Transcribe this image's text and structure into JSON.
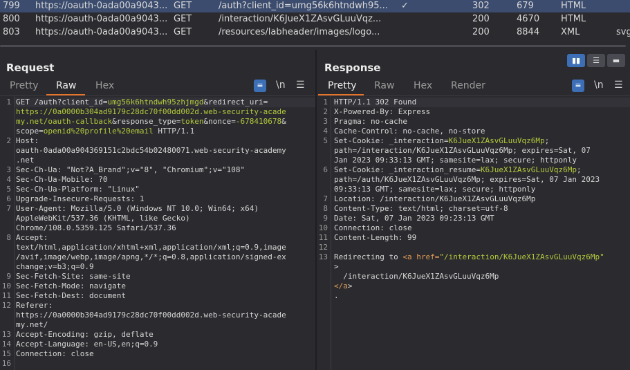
{
  "table": {
    "rows": [
      {
        "num": "799",
        "host": "https://oauth-0ada00a9043...",
        "method": "GET",
        "url": "/auth?client_id=umg56k6htndwh95...",
        "check": "✓",
        "status": "302",
        "length": "679",
        "mime": "HTML",
        "ext": ""
      },
      {
        "num": "800",
        "host": "https://oauth-0ada00a9043...",
        "method": "GET",
        "url": "/interaction/K6JueX1ZAsvGLuuVqz...",
        "check": "",
        "status": "200",
        "length": "4670",
        "mime": "HTML",
        "ext": ""
      },
      {
        "num": "803",
        "host": "https://oauth-0ada00a9043...",
        "method": "GET",
        "url": "/resources/labheader/images/logo...",
        "check": "",
        "status": "200",
        "length": "8844",
        "mime": "XML",
        "ext": "svg"
      }
    ]
  },
  "request": {
    "title": "Request",
    "tabs": [
      "Pretty",
      "Raw",
      "Hex"
    ],
    "wrap_icon": "wrap-icon",
    "newline_label": "\\n",
    "menu_icon": "menu-icon",
    "lines": [
      {
        "n": "1",
        "parts": [
          [
            "k",
            "GET /auth?client_id="
          ],
          [
            "v",
            "umg56k6htndwh95zhjmgd"
          ],
          [
            "k",
            "&redirect_uri="
          ]
        ]
      },
      {
        "n": "",
        "parts": [
          [
            "v",
            "https://0a0000b304ad9179c28dc70f00dd002d.web-security-acade"
          ]
        ]
      },
      {
        "n": "",
        "parts": [
          [
            "v",
            "my.net/oauth-callback"
          ],
          [
            "k",
            "&response_type="
          ],
          [
            "v",
            "token"
          ],
          [
            "k",
            "&nonce="
          ],
          [
            "v",
            "-678410678"
          ],
          [
            "k",
            "&"
          ]
        ]
      },
      {
        "n": "",
        "parts": [
          [
            "k",
            "scope="
          ],
          [
            "v",
            "openid%20profile%20email"
          ],
          [
            "k",
            " HTTP/1.1"
          ]
        ]
      },
      {
        "n": "2",
        "parts": [
          [
            "k",
            "Host:"
          ]
        ]
      },
      {
        "n": "",
        "parts": [
          [
            "m",
            "oauth-0ada00a904369151c2bdc54b02480071.web-security-academy"
          ]
        ]
      },
      {
        "n": "",
        "parts": [
          [
            "m",
            ".net"
          ]
        ]
      },
      {
        "n": "3",
        "parts": [
          [
            "k",
            "Sec-Ch-Ua: "
          ],
          [
            "m",
            "\"Not?A_Brand\";v=\"8\", \"Chromium\";v=\"108\""
          ]
        ]
      },
      {
        "n": "4",
        "parts": [
          [
            "k",
            "Sec-Ch-Ua-Mobile: "
          ],
          [
            "m",
            "?0"
          ]
        ]
      },
      {
        "n": "5",
        "parts": [
          [
            "k",
            "Sec-Ch-Ua-Platform: "
          ],
          [
            "m",
            "\"Linux\""
          ]
        ]
      },
      {
        "n": "6",
        "parts": [
          [
            "k",
            "Upgrade-Insecure-Requests: "
          ],
          [
            "m",
            "1"
          ]
        ]
      },
      {
        "n": "7",
        "parts": [
          [
            "k",
            "User-Agent: "
          ],
          [
            "m",
            "Mozilla/5.0 (Windows NT 10.0; Win64; x64)"
          ]
        ]
      },
      {
        "n": "",
        "parts": [
          [
            "m",
            "AppleWebKit/537.36 (KHTML, like Gecko)"
          ]
        ]
      },
      {
        "n": "",
        "parts": [
          [
            "m",
            "Chrome/108.0.5359.125 Safari/537.36"
          ]
        ]
      },
      {
        "n": "8",
        "parts": [
          [
            "k",
            "Accept:"
          ]
        ]
      },
      {
        "n": "",
        "parts": [
          [
            "m",
            "text/html,application/xhtml+xml,application/xml;q=0.9,image"
          ]
        ]
      },
      {
        "n": "",
        "parts": [
          [
            "m",
            "/avif,image/webp,image/apng,*/*;q=0.8,application/signed-ex"
          ]
        ]
      },
      {
        "n": "",
        "parts": [
          [
            "m",
            "change;v=b3;q=0.9"
          ]
        ]
      },
      {
        "n": "9",
        "parts": [
          [
            "k",
            "Sec-Fetch-Site: "
          ],
          [
            "m",
            "same-site"
          ]
        ]
      },
      {
        "n": "10",
        "parts": [
          [
            "k",
            "Sec-Fetch-Mode: "
          ],
          [
            "m",
            "navigate"
          ]
        ]
      },
      {
        "n": "11",
        "parts": [
          [
            "k",
            "Sec-Fetch-Dest: "
          ],
          [
            "m",
            "document"
          ]
        ]
      },
      {
        "n": "12",
        "parts": [
          [
            "k",
            "Referer:"
          ]
        ]
      },
      {
        "n": "",
        "parts": [
          [
            "m",
            "https://0a0000b304ad9179c28dc70f00dd002d.web-security-acade"
          ]
        ]
      },
      {
        "n": "",
        "parts": [
          [
            "m",
            "my.net/"
          ]
        ]
      },
      {
        "n": "13",
        "parts": [
          [
            "k",
            "Accept-Encoding: "
          ],
          [
            "m",
            "gzip, deflate"
          ]
        ]
      },
      {
        "n": "14",
        "parts": [
          [
            "k",
            "Accept-Language: "
          ],
          [
            "m",
            "en-US,en;q=0.9"
          ]
        ]
      },
      {
        "n": "15",
        "parts": [
          [
            "k",
            "Connection: "
          ],
          [
            "m",
            "close"
          ]
        ]
      },
      {
        "n": "16",
        "parts": [
          [
            "m",
            ""
          ]
        ]
      }
    ]
  },
  "response": {
    "title": "Response",
    "tabs": [
      "Pretty",
      "Raw",
      "Hex",
      "Render"
    ],
    "layout_icons": [
      "split-vertical-icon",
      "split-horizontal-icon",
      "single-pane-icon"
    ],
    "lines": [
      {
        "n": "1",
        "parts": [
          [
            "k",
            "HTTP/1.1 302 Found"
          ]
        ]
      },
      {
        "n": "2",
        "parts": [
          [
            "k",
            "X-Powered-By: "
          ],
          [
            "m",
            "Express"
          ]
        ]
      },
      {
        "n": "3",
        "parts": [
          [
            "k",
            "Pragma: "
          ],
          [
            "m",
            "no-cache"
          ]
        ]
      },
      {
        "n": "4",
        "parts": [
          [
            "k",
            "Cache-Control: "
          ],
          [
            "m",
            "no-cache, no-store"
          ]
        ]
      },
      {
        "n": "5",
        "parts": [
          [
            "k",
            "Set-Cookie: "
          ],
          [
            "m",
            "_interaction="
          ],
          [
            "v",
            "K6JueX1ZAsvGLuuVqz6Mp"
          ],
          [
            "m",
            ";"
          ]
        ]
      },
      {
        "n": "",
        "parts": [
          [
            "m",
            "path=/interaction/K6JueX1ZAsvGLuuVqz6Mp; expires=Sat, 07"
          ]
        ]
      },
      {
        "n": "",
        "parts": [
          [
            "m",
            "Jan 2023 09:33:13 GMT; samesite=lax; secure; httponly"
          ]
        ]
      },
      {
        "n": "6",
        "parts": [
          [
            "k",
            "Set-Cookie: "
          ],
          [
            "m",
            "_interaction_resume="
          ],
          [
            "v",
            "K6JueX1ZAsvGLuuVqz6Mp"
          ],
          [
            "m",
            ";"
          ]
        ]
      },
      {
        "n": "",
        "parts": [
          [
            "m",
            "path=/auth/K6JueX1ZAsvGLuuVqz6Mp; expires=Sat, 07 Jan 2023"
          ]
        ]
      },
      {
        "n": "",
        "parts": [
          [
            "m",
            "09:33:13 GMT; samesite=lax; secure; httponly"
          ]
        ]
      },
      {
        "n": "7",
        "parts": [
          [
            "k",
            "Location: "
          ],
          [
            "m",
            "/interaction/K6JueX1ZAsvGLuuVqz6Mp"
          ]
        ]
      },
      {
        "n": "8",
        "parts": [
          [
            "k",
            "Content-Type: "
          ],
          [
            "m",
            "text/html; charset=utf-8"
          ]
        ]
      },
      {
        "n": "9",
        "parts": [
          [
            "k",
            "Date: "
          ],
          [
            "m",
            "Sat, 07 Jan 2023 09:23:13 GMT"
          ]
        ]
      },
      {
        "n": "10",
        "parts": [
          [
            "k",
            "Connection: "
          ],
          [
            "m",
            "close"
          ]
        ]
      },
      {
        "n": "11",
        "parts": [
          [
            "k",
            "Content-Length: "
          ],
          [
            "m",
            "99"
          ]
        ]
      },
      {
        "n": "12",
        "parts": [
          [
            "m",
            ""
          ]
        ]
      },
      {
        "n": "13",
        "parts": [
          [
            "k",
            "Redirecting to "
          ],
          [
            "tag",
            "<a "
          ],
          [
            "tag",
            "href="
          ],
          [
            "v",
            "\"/interaction/K6JueX1ZAsvGLuuVqz6Mp\""
          ]
        ]
      },
      {
        "n": "",
        "parts": [
          [
            "m",
            ">"
          ]
        ]
      },
      {
        "n": "",
        "parts": [
          [
            "m",
            "  /interaction/K6JueX1ZAsvGLuuVqz6Mp"
          ]
        ]
      },
      {
        "n": "",
        "parts": [
          [
            "tag",
            "</a"
          ],
          [
            "m",
            ">"
          ]
        ]
      },
      {
        "n": "",
        "parts": [
          [
            "m",
            "."
          ]
        ]
      }
    ]
  }
}
